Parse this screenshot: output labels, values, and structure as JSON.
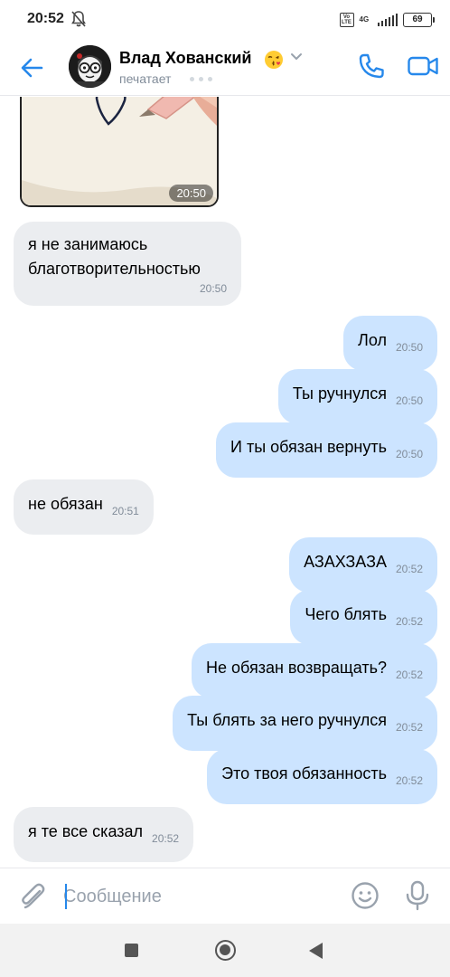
{
  "status_bar": {
    "time": "20:52",
    "volte_label": "Vo LTE",
    "network": "4G",
    "battery": "69",
    "icons": [
      "bell-muted-icon",
      "volte-icon",
      "signal-icon",
      "battery-icon"
    ]
  },
  "header": {
    "contact_name": "Влад Хованский",
    "status": "печатает",
    "icons": [
      "back-arrow-icon",
      "kiss-emoji-icon",
      "chevron-down-icon",
      "phone-icon",
      "video-camera-icon"
    ],
    "accent_color": "#2688eb"
  },
  "messages": [
    {
      "type": "photo",
      "direction": "in",
      "time": "20:50"
    },
    {
      "type": "text",
      "direction": "in",
      "text": "я не занимаюсь благотворительностью",
      "time": "20:50"
    },
    {
      "type": "text",
      "direction": "out",
      "text": "Лол",
      "time": "20:50"
    },
    {
      "type": "text",
      "direction": "out",
      "text": "Ты ручнулся",
      "time": "20:50"
    },
    {
      "type": "text",
      "direction": "out",
      "text": "И ты обязан вернуть",
      "time": "20:50"
    },
    {
      "type": "text",
      "direction": "in",
      "text": "не обязан",
      "time": "20:51"
    },
    {
      "type": "text",
      "direction": "out",
      "text": "АЗАХЗАЗА",
      "time": "20:52"
    },
    {
      "type": "text",
      "direction": "out",
      "text": "Чего блять",
      "time": "20:52"
    },
    {
      "type": "text",
      "direction": "out",
      "text": "Не обязан возвращать?",
      "time": "20:52"
    },
    {
      "type": "text",
      "direction": "out",
      "text": "Ты блять за него ручнулся",
      "time": "20:52"
    },
    {
      "type": "text",
      "direction": "out",
      "text": "Это твоя обязанность",
      "time": "20:52"
    },
    {
      "type": "text",
      "direction": "in",
      "text": "я те все сказал",
      "time": "20:52"
    }
  ],
  "colors": {
    "incoming_bubble": "#ebedf0",
    "outgoing_bubble": "#cce4ff",
    "time_text": "#818c99"
  },
  "composer": {
    "placeholder": "Сообщение",
    "value": "",
    "icons": [
      "paperclip-icon",
      "smile-icon",
      "microphone-icon"
    ]
  },
  "nav_bar": {
    "icons": [
      "recent-apps-icon",
      "home-icon",
      "back-triangle-icon"
    ]
  }
}
